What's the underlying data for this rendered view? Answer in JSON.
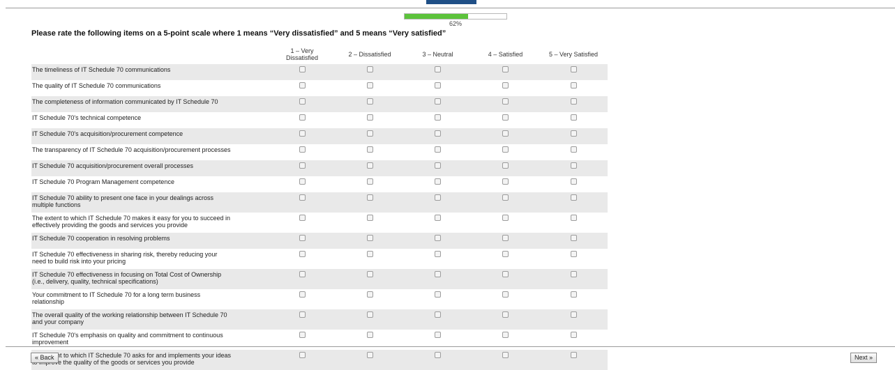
{
  "progress": {
    "percent": 62,
    "label": "62%"
  },
  "question": "Please rate the following items on a 5-point scale where 1 means “Very dissatisfied” and 5 means “Very satisfied”",
  "scale": [
    {
      "line1": "1 – Very",
      "line2": "Dissatisfied"
    },
    {
      "line1": "2 – Dissatisfied",
      "line2": ""
    },
    {
      "line1": "3 – Neutral",
      "line2": ""
    },
    {
      "line1": "4 – Satisfied",
      "line2": ""
    },
    {
      "line1": "5 – Very Satisfied",
      "line2": ""
    }
  ],
  "items": [
    {
      "line1": "The timeliness of IT Schedule 70 communications",
      "line2": ""
    },
    {
      "line1": "The quality of IT Schedule 70 communications",
      "line2": ""
    },
    {
      "line1": "The completeness of information communicated by IT Schedule 70",
      "line2": ""
    },
    {
      "line1": "IT Schedule 70's technical competence",
      "line2": ""
    },
    {
      "line1": "IT Schedule 70's acquisition/procurement competence",
      "line2": ""
    },
    {
      "line1": "The transparency of IT Schedule 70 acquisition/procurement processes",
      "line2": ""
    },
    {
      "line1": "IT Schedule 70 acquisition/procurement overall processes",
      "line2": ""
    },
    {
      "line1": "IT Schedule 70 Program Management competence",
      "line2": ""
    },
    {
      "line1": "IT Schedule 70 ability to present one face in your dealings across",
      "line2": "multiple functions"
    },
    {
      "line1": "The extent to which IT Schedule 70 makes it easy for you to succeed in",
      "line2": "effectively providing the goods and services you provide"
    },
    {
      "line1": "IT Schedule 70 cooperation in resolving problems",
      "line2": ""
    },
    {
      "line1": "IT Schedule 70 effectiveness in sharing risk, thereby reducing your",
      "line2": "need to build risk into your pricing"
    },
    {
      "line1": "IT Schedule 70 effectiveness in focusing on Total Cost of Ownership",
      "line2": "(i.e., delivery, quality, technical specifications)"
    },
    {
      "line1": "Your commitment to IT Schedule 70 for a long term business",
      "line2": "relationship"
    },
    {
      "line1": "The overall quality of the working relationship between IT Schedule 70",
      "line2": "and your company"
    },
    {
      "line1": "IT Schedule 70's emphasis on quality and commitment to continuous",
      "line2": "improvement"
    },
    {
      "line1": "The extent to which IT Schedule 70 asks for and implements your ideas",
      "line2": "to improve the quality of the goods or services you provide"
    }
  ],
  "nav": {
    "back": "« Back",
    "next": "Next »"
  },
  "colors": {
    "progress_fill": "#5cc33b",
    "row_shade": "#e9e9e9",
    "top_tab": "#1f4f86"
  }
}
